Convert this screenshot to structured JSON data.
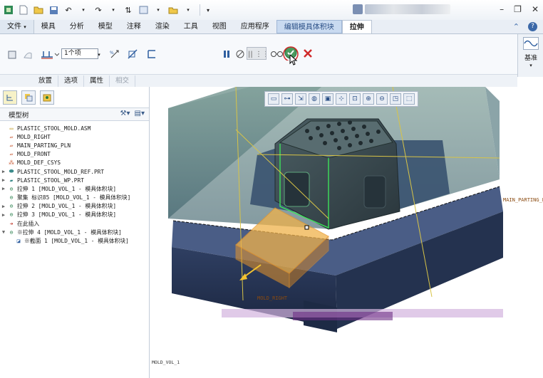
{
  "menu": {
    "file": "文件",
    "file_arrow": "▾",
    "tabs": [
      "模具",
      "分析",
      "模型",
      "注释",
      "渲染",
      "工具",
      "视图",
      "应用程序"
    ],
    "mold_tab": "编辑模具体积块",
    "active_tab": "拉伸"
  },
  "ribbon": {
    "option_value": "1个项",
    "subtabs": [
      "放置",
      "选项",
      "属性",
      "相交"
    ],
    "datum_label": "基准"
  },
  "model_tree": {
    "title": "模型树",
    "items": [
      {
        "label": "PLASTIC_STOOL_MOLD.ASM",
        "level": 0
      },
      {
        "label": "MOLD_RIGHT",
        "level": 1
      },
      {
        "label": "MAIN_PARTING_PLN",
        "level": 1
      },
      {
        "label": "MOLD_FRONT",
        "level": 1
      },
      {
        "label": "MOLD_DEF_CSYS",
        "level": 1
      },
      {
        "label": "PLASTIC_STOOL_MOLD_REF.PRT",
        "level": 1
      },
      {
        "label": "PLASTIC_STOOL_WP.PRT",
        "level": 1
      },
      {
        "label": "拉伸 1 [MOLD_VOL_1 - 模具体积块]",
        "level": 1
      },
      {
        "label": "聚集 标识85 [MOLD_VOL_1 - 模具体积块]",
        "level": 1
      },
      {
        "label": "拉伸 2 [MOLD_VOL_1 - 模具体积块]",
        "level": 1
      },
      {
        "label": "拉伸 3 [MOLD_VOL_1 - 模具体积块]",
        "level": 1
      },
      {
        "label": "在此插入",
        "level": 1
      },
      {
        "label": "※拉伸 4 [MOLD_VOL_1 - 模具体积块]",
        "level": 1
      },
      {
        "label": "※截面 1 [MOLD_VOL_1 - 模具体积块]",
        "level": 2
      }
    ]
  },
  "viewport": {
    "label_parting": "MAIN_PARTING_PL",
    "label_right": "MOLD_RIGHT",
    "bottom_label": "MOLD_VOL_1"
  }
}
